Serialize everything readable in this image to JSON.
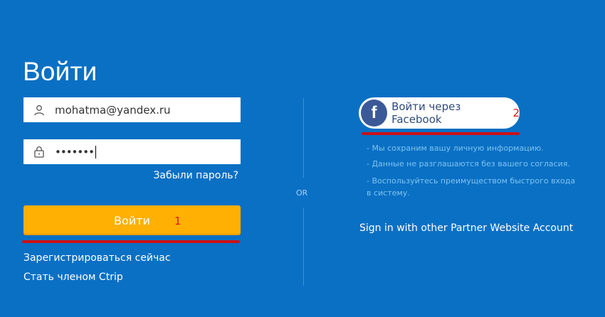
{
  "login": {
    "title": "Войти",
    "username_value": "mohatma@yandex.ru",
    "password_mask": "•••••••",
    "forgot_label": "Забыли пароль?",
    "submit_label": "Войти",
    "submit_marker": "1",
    "register_label": "Зарегистрироваться сейчас",
    "member_label": "Стать членом Ctrip",
    "icons": {
      "user": "user-icon",
      "lock": "lock-icon"
    }
  },
  "divider": {
    "or_label": "OR"
  },
  "social": {
    "facebook_label": "Войти через Facebook",
    "facebook_marker": "2",
    "benefits": [
      "- Мы сохраним вашу личную информацию.",
      "- Данные не разглашаются без вашего согласия.",
      "- Воспользуйтесь преимуществом быстрого входа в систему."
    ],
    "partner_label": "Sign in with other Partner Website Account",
    "icon": "facebook-icon"
  },
  "colors": {
    "background": "#0a70c4",
    "primary_button": "#ffb003",
    "highlight": "#cc1016",
    "facebook": "#3b5998"
  }
}
